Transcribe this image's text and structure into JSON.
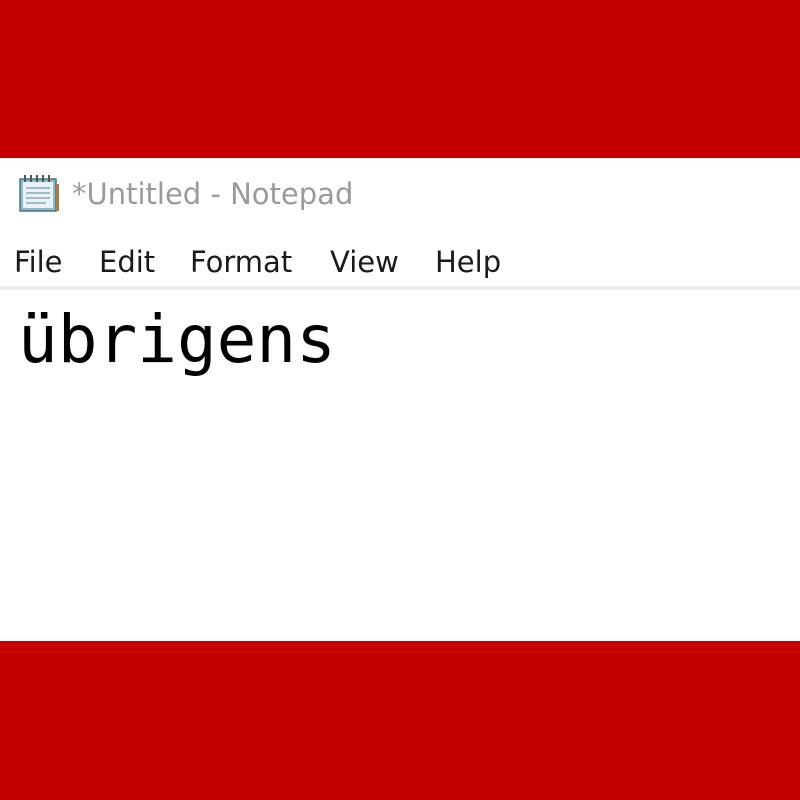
{
  "window": {
    "title": "*Untitled - Notepad",
    "app_icon": "notepad-icon"
  },
  "menu": {
    "items": [
      {
        "label": "File"
      },
      {
        "label": "Edit"
      },
      {
        "label": "Format"
      },
      {
        "label": "View"
      },
      {
        "label": "Help"
      }
    ]
  },
  "editor": {
    "text": "übrigens"
  },
  "colors": {
    "background_band": "#c40000",
    "window": "#ffffff",
    "title_text": "#9a9a9a",
    "menu_text": "#1a1a1a"
  }
}
